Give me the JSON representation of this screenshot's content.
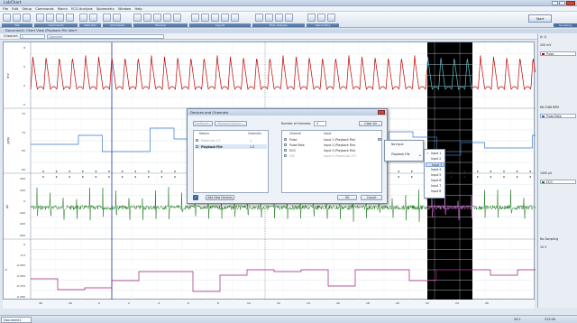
{
  "window": {
    "title": "LabChart"
  },
  "menubar": [
    "File",
    "Edit",
    "Setup",
    "Commands",
    "Macro",
    "ECG Analysis",
    "Spirometry",
    "Window",
    "Help"
  ],
  "ribbon_groups": [
    "File",
    "Commands",
    "Data Pad",
    "Comments",
    "Window",
    "Layout",
    "ECG Analysis",
    "Spirometry"
  ],
  "start_button": "Start",
  "sampling_label": "Sampling",
  "document_title": "Document1: Chart View (Playback File Idle)*",
  "channel_bar": {
    "label": "Channel:",
    "channel_value": "1",
    "comment_placeholder": "Comment"
  },
  "panels": [
    {
      "unit": "mV",
      "ticks": [
        "8",
        "5",
        "0",
        "-5"
      ]
    },
    {
      "unit": "BPM",
      "ticks": [
        "75",
        "70",
        "65",
        "60"
      ]
    },
    {
      "unit": "µV",
      "ticks": [
        "400",
        "200",
        "0",
        "-200",
        "-400",
        "-600"
      ]
    },
    {
      "unit": "V",
      "ticks": [
        "0",
        "-0.5",
        "-0.560",
        "-0.565",
        "-0.575",
        "-0.580"
      ]
    }
  ],
  "right_panels": [
    {
      "readout": "(k 1)",
      "range": "200 mV",
      "name": "Pulse",
      "color": "#c00000"
    },
    {
      "readout": "66.3168 BPM",
      "range": "",
      "name": "Pulse Rate",
      "color": "#2b6cc4"
    },
    {
      "readout": "1000 µV",
      "range": "",
      "name": "ECG",
      "color": "#1d7a1d"
    },
    {
      "readout": "No Sampling",
      "range": "10 V",
      "name": "",
      "color": "#a0207a"
    }
  ],
  "xaxis_ticks": [
    "46",
    "44",
    "0",
    "2",
    "4",
    "6",
    "8",
    "10",
    "12",
    "14",
    "16",
    "18",
    "20",
    "22",
    "24",
    "26"
  ],
  "status": {
    "doc_tab": "Document1",
    "zoom": "20:1",
    "time": "312:00"
  },
  "dialog": {
    "title": "Devices and Channels",
    "btn_configure": "Configure...",
    "btn_rename": "Rename Device...",
    "num_channels_label": "Number of channels:",
    "num_channels_value": "4",
    "btn_clear_all": "Clear All",
    "headers": {
      "device": "Device",
      "channels": "Channels",
      "channel": "Channel",
      "input": "Input"
    },
    "devices": [
      {
        "name": "PowerLab 2/T",
        "channels": "4",
        "checked": false
      },
      {
        "name": "Playback File",
        "channels": "1-3",
        "checked": true
      }
    ],
    "channels": [
      {
        "channel": "Pulse",
        "input": "Input 1 (Playback File)",
        "checked": true
      },
      {
        "channel": "Pulse Rate",
        "input": "Input 2 (Playback File)",
        "checked": true
      },
      {
        "channel": "ECG",
        "input": "Input 3 (Playback File)",
        "checked": true
      },
      {
        "channel": "QTy",
        "input": "Input 4 (PowerLab 2/T)",
        "checked": false
      }
    ],
    "btn_add": "Add New Devices",
    "btn_ok": "OK",
    "btn_cancel": "Cancel"
  },
  "menu1": [
    "No Input",
    "Playback File"
  ],
  "menu2": [
    "Input 1",
    "Input 2",
    "Input 3",
    "Input 4",
    "Input 5",
    "Input 6",
    "Input 7",
    "Input 8"
  ]
}
